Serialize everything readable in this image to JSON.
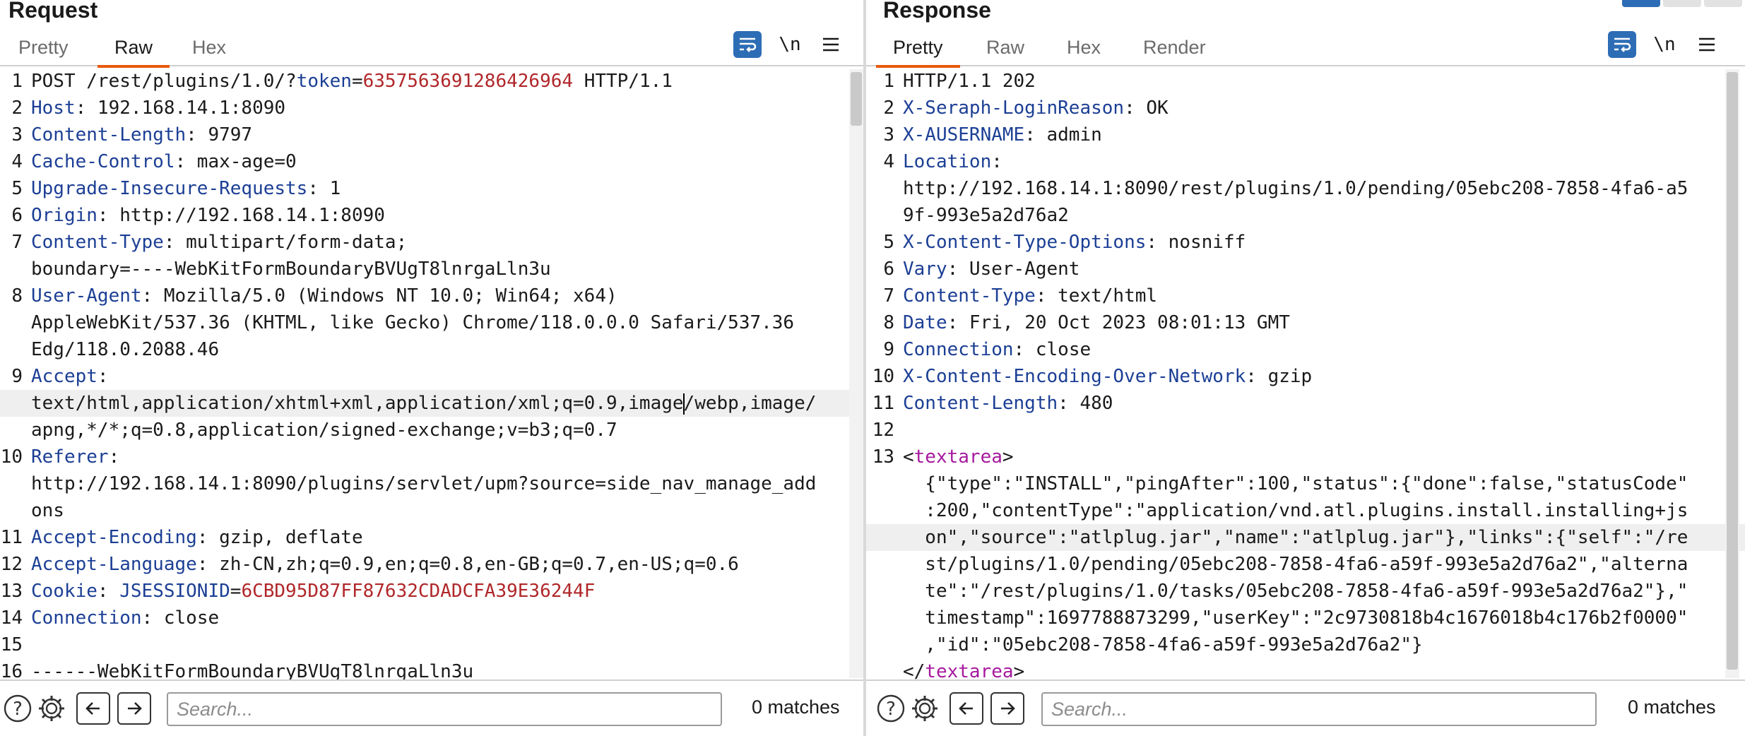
{
  "request": {
    "title": "Request",
    "tabs": [
      "Pretty",
      "Raw",
      "Hex"
    ],
    "active_tab": "Raw",
    "newline_label": "\\n",
    "lines": [
      {
        "n": "1",
        "segs": [
          [
            "POST /rest/plugins/1.0/?",
            ""
          ],
          [
            "token",
            "param"
          ],
          [
            "=",
            ""
          ],
          [
            "6357563691286426964",
            "val"
          ],
          [
            " HTTP/1.1",
            ""
          ]
        ]
      },
      {
        "n": "2",
        "segs": [
          [
            "Host",
            "hdr"
          ],
          [
            ": 192.168.14.1:8090",
            ""
          ]
        ]
      },
      {
        "n": "3",
        "segs": [
          [
            "Content-Length",
            "hdr"
          ],
          [
            ": 9797",
            ""
          ]
        ]
      },
      {
        "n": "4",
        "segs": [
          [
            "Cache-Control",
            "hdr"
          ],
          [
            ": max-age=0",
            ""
          ]
        ]
      },
      {
        "n": "5",
        "segs": [
          [
            "Upgrade-Insecure-Requests",
            "hdr"
          ],
          [
            ": 1",
            ""
          ]
        ]
      },
      {
        "n": "6",
        "segs": [
          [
            "Origin",
            "hdr"
          ],
          [
            ": http://192.168.14.1:8090",
            ""
          ]
        ]
      },
      {
        "n": "7",
        "segs": [
          [
            "Content-Type",
            "hdr"
          ],
          [
            ": multipart/form-data;",
            ""
          ]
        ]
      },
      {
        "n": "",
        "segs": [
          [
            "boundary=----WebKitFormBoundaryBVUgT8lnrgaLln3u",
            ""
          ]
        ]
      },
      {
        "n": "8",
        "segs": [
          [
            "User-Agent",
            "hdr"
          ],
          [
            ": Mozilla/5.0 (Windows NT 10.0; Win64; x64)",
            ""
          ]
        ]
      },
      {
        "n": "",
        "segs": [
          [
            "AppleWebKit/537.36 (KHTML, like Gecko) Chrome/118.0.0.0 Safari/537.36",
            ""
          ]
        ]
      },
      {
        "n": "",
        "segs": [
          [
            "Edg/118.0.2088.46",
            ""
          ]
        ]
      },
      {
        "n": "9",
        "segs": [
          [
            "Accept",
            "hdr"
          ],
          [
            ":",
            ""
          ]
        ]
      },
      {
        "n": "",
        "hl": true,
        "segs": [
          [
            "text/html,application/xhtml+xml,application/xml;q=0.9,image",
            ""
          ],
          [
            "|",
            "cursor"
          ],
          [
            "/webp,image/",
            ""
          ]
        ]
      },
      {
        "n": "",
        "segs": [
          [
            "apng,*/*;q=0.8,application/signed-exchange;v=b3;q=0.7",
            ""
          ]
        ]
      },
      {
        "n": "10",
        "segs": [
          [
            "Referer",
            "hdr"
          ],
          [
            ":",
            ""
          ]
        ]
      },
      {
        "n": "",
        "segs": [
          [
            "http://192.168.14.1:8090/plugins/servlet/upm?source=side_nav_manage_add",
            ""
          ]
        ]
      },
      {
        "n": "",
        "segs": [
          [
            "ons",
            ""
          ]
        ]
      },
      {
        "n": "11",
        "segs": [
          [
            "Accept-Encoding",
            "hdr"
          ],
          [
            ": gzip, deflate",
            ""
          ]
        ]
      },
      {
        "n": "12",
        "segs": [
          [
            "Accept-Language",
            "hdr"
          ],
          [
            ": zh-CN,zh;q=0.9,en;q=0.8,en-GB;q=0.7,en-US;q=0.6",
            ""
          ]
        ]
      },
      {
        "n": "13",
        "segs": [
          [
            "Cookie",
            "hdr"
          ],
          [
            ": ",
            ""
          ],
          [
            "JSESSIONID",
            "param"
          ],
          [
            "=",
            ""
          ],
          [
            "6CBD95D87FF87632CDADCFA39E36244F",
            "val"
          ]
        ]
      },
      {
        "n": "14",
        "segs": [
          [
            "Connection",
            "hdr"
          ],
          [
            ": close",
            ""
          ]
        ]
      },
      {
        "n": "15",
        "segs": [
          [
            "",
            ""
          ]
        ]
      },
      {
        "n": "16",
        "segs": [
          [
            "------WebKitFormBoundaryBVUgT8lnrgaLln3u",
            ""
          ]
        ]
      }
    ],
    "search": {
      "placeholder": "Search...",
      "matches": "0 matches"
    }
  },
  "response": {
    "title": "Response",
    "tabs": [
      "Pretty",
      "Raw",
      "Hex",
      "Render"
    ],
    "active_tab": "Pretty",
    "newline_label": "\\n",
    "lines": [
      {
        "n": "1",
        "segs": [
          [
            "HTTP/1.1 202",
            ""
          ]
        ]
      },
      {
        "n": "2",
        "segs": [
          [
            "X-Seraph-LoginReason",
            "hdr"
          ],
          [
            ": OK",
            ""
          ]
        ]
      },
      {
        "n": "3",
        "segs": [
          [
            "X-AUSERNAME",
            "hdr"
          ],
          [
            ": admin",
            ""
          ]
        ]
      },
      {
        "n": "4",
        "segs": [
          [
            "Location",
            "hdr"
          ],
          [
            ":",
            ""
          ]
        ]
      },
      {
        "n": "",
        "segs": [
          [
            "http://192.168.14.1:8090/rest/plugins/1.0/pending/05ebc208-7858-4fa6-a5",
            ""
          ]
        ]
      },
      {
        "n": "",
        "segs": [
          [
            "9f-993e5a2d76a2",
            ""
          ]
        ]
      },
      {
        "n": "5",
        "segs": [
          [
            "X-Content-Type-Options",
            "hdr"
          ],
          [
            ": nosniff",
            ""
          ]
        ]
      },
      {
        "n": "6",
        "segs": [
          [
            "Vary",
            "hdr"
          ],
          [
            ": User-Agent",
            ""
          ]
        ]
      },
      {
        "n": "7",
        "segs": [
          [
            "Content-Type",
            "hdr"
          ],
          [
            ": text/html",
            ""
          ]
        ]
      },
      {
        "n": "8",
        "segs": [
          [
            "Date",
            "hdr"
          ],
          [
            ": Fri, 20 Oct 2023 08:01:13 GMT",
            ""
          ]
        ]
      },
      {
        "n": "9",
        "segs": [
          [
            "Connection",
            "hdr"
          ],
          [
            ": close",
            ""
          ]
        ]
      },
      {
        "n": "10",
        "segs": [
          [
            "X-Content-Encoding-Over-Network",
            "hdr"
          ],
          [
            ": gzip",
            ""
          ]
        ]
      },
      {
        "n": "11",
        "segs": [
          [
            "Content-Length",
            "hdr"
          ],
          [
            ": 480",
            ""
          ]
        ]
      },
      {
        "n": "12",
        "segs": [
          [
            "",
            ""
          ]
        ]
      },
      {
        "n": "13",
        "segs": [
          [
            "<",
            ""
          ],
          [
            "textarea",
            "tag"
          ],
          [
            ">",
            ""
          ]
        ]
      },
      {
        "n": "",
        "segs": [
          [
            "  {\"type\":\"INSTALL\",\"pingAfter\":100,\"status\":{\"done\":false,\"statusCode\"",
            ""
          ]
        ]
      },
      {
        "n": "",
        "segs": [
          [
            "  :200,\"contentType\":\"application/vnd.atl.plugins.install.installing+js",
            ""
          ]
        ]
      },
      {
        "n": "",
        "hl": true,
        "segs": [
          [
            "  on\",\"source\":\"atlplug.jar\",\"name\":\"atlplug.jar\"},\"links\":{\"self\":\"/re",
            ""
          ]
        ]
      },
      {
        "n": "",
        "segs": [
          [
            "  st/plugins/1.0/pending/05ebc208-7858-4fa6-a59f-993e5a2d76a2\",\"alterna",
            ""
          ]
        ]
      },
      {
        "n": "",
        "segs": [
          [
            "  te\":\"/rest/plugins/1.0/tasks/05ebc208-7858-4fa6-a59f-993e5a2d76a2\"},\"",
            ""
          ]
        ]
      },
      {
        "n": "",
        "segs": [
          [
            "  timestamp\":1697788873299,\"userKey\":\"2c9730818b4c1676018b4c176b2f0000\"",
            ""
          ]
        ]
      },
      {
        "n": "",
        "segs": [
          [
            "  ,\"id\":\"05ebc208-7858-4fa6-a59f-993e5a2d76a2\"}",
            ""
          ]
        ]
      },
      {
        "n": "",
        "segs": [
          [
            "</",
            ""
          ],
          [
            "textarea",
            "tag"
          ],
          [
            ">",
            ""
          ]
        ]
      }
    ],
    "search": {
      "placeholder": "Search...",
      "matches": "0 matches"
    }
  }
}
